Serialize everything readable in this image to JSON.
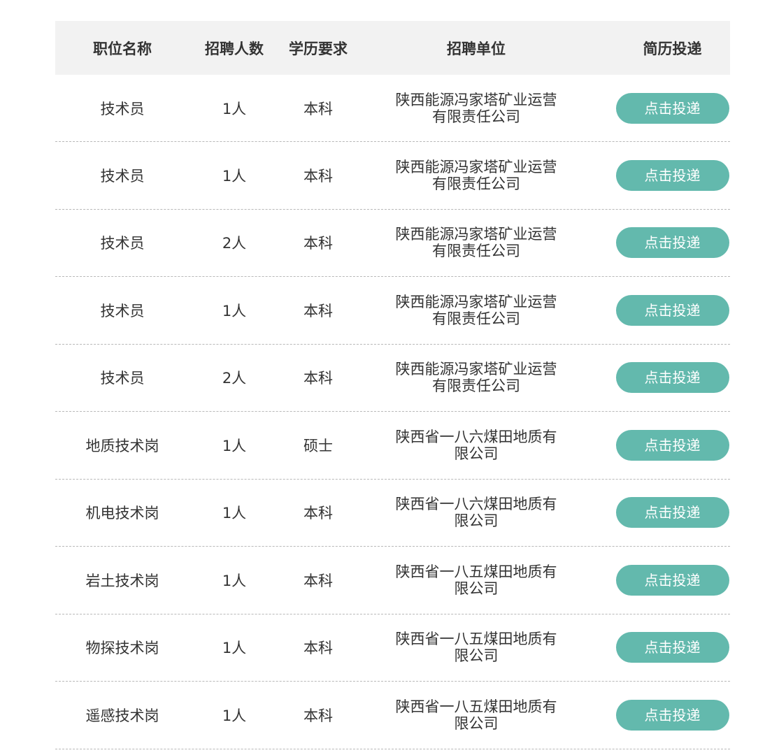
{
  "header": {
    "position": "职位名称",
    "count": "招聘人数",
    "education": "学历要求",
    "employer": "招聘单位",
    "apply": "简历投递"
  },
  "rows": [
    {
      "position": "技术员",
      "count": "1人",
      "education": "本科",
      "employer_line1": "陕西能源冯家塔矿业运营",
      "employer_line2": "有限责任公司",
      "button": "点击投递"
    },
    {
      "position": "技术员",
      "count": "1人",
      "education": "本科",
      "employer_line1": "陕西能源冯家塔矿业运营",
      "employer_line2": "有限责任公司",
      "button": "点击投递"
    },
    {
      "position": "技术员",
      "count": "2人",
      "education": "本科",
      "employer_line1": "陕西能源冯家塔矿业运营",
      "employer_line2": "有限责任公司",
      "button": "点击投递"
    },
    {
      "position": "技术员",
      "count": "1人",
      "education": "本科",
      "employer_line1": "陕西能源冯家塔矿业运营",
      "employer_line2": "有限责任公司",
      "button": "点击投递"
    },
    {
      "position": "技术员",
      "count": "2人",
      "education": "本科",
      "employer_line1": "陕西能源冯家塔矿业运营",
      "employer_line2": "有限责任公司",
      "button": "点击投递"
    },
    {
      "position": "地质技术岗",
      "count": "1人",
      "education": "硕士",
      "employer_line1": "陕西省一八六煤田地质有",
      "employer_line2": "限公司",
      "button": "点击投递"
    },
    {
      "position": "机电技术岗",
      "count": "1人",
      "education": "本科",
      "employer_line1": "陕西省一八六煤田地质有",
      "employer_line2": "限公司",
      "button": "点击投递"
    },
    {
      "position": "岩土技术岗",
      "count": "1人",
      "education": "本科",
      "employer_line1": "陕西省一八五煤田地质有",
      "employer_line2": "限公司",
      "button": "点击投递"
    },
    {
      "position": "物探技术岗",
      "count": "1人",
      "education": "本科",
      "employer_line1": "陕西省一八五煤田地质有",
      "employer_line2": "限公司",
      "button": "点击投递"
    },
    {
      "position": "遥感技术岗",
      "count": "1人",
      "education": "本科",
      "employer_line1": "陕西省一八五煤田地质有",
      "employer_line2": "限公司",
      "button": "点击投递"
    }
  ],
  "colors": {
    "button_bg": "#63b9ad",
    "header_bg": "#f2f2f2",
    "text": "#333333"
  }
}
